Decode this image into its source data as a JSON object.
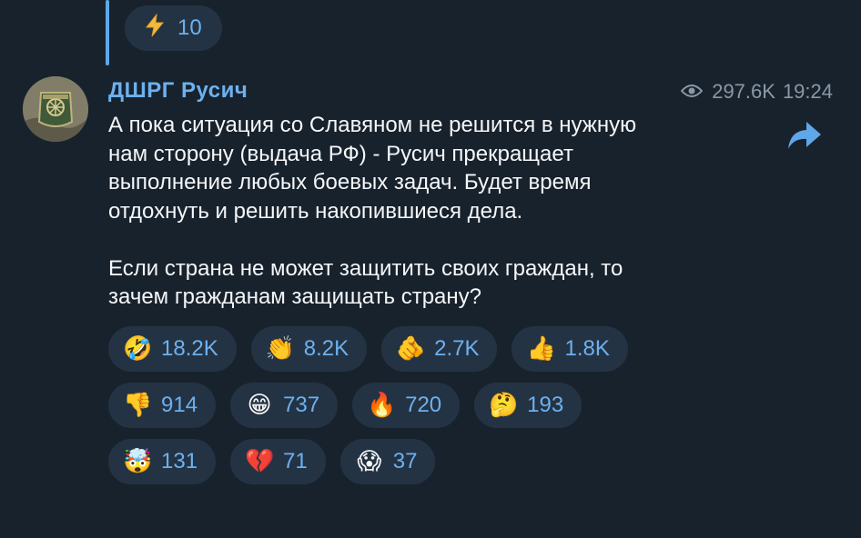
{
  "previous_message": {
    "reaction": {
      "icon": "lightning-icon",
      "emoji": "⚡",
      "count": "10"
    }
  },
  "message": {
    "author": "ДШРГ Русич",
    "views": "297.6K",
    "time": "19:24",
    "paragraphs": [
      "А пока ситуация со Славяном не решится в нужную\nнам сторону (выдача РФ) - Русич прекращает\nвыполнение любых боевых задач. Будет время\nотдохнуть и решить накопившиеся дела.",
      "Если страна не может защитить своих граждан, то\nзачем гражданам защищать страну?"
    ]
  },
  "reactions": [
    [
      {
        "icon": "rofl-icon",
        "emoji": "🤣",
        "count": "18.2K"
      },
      {
        "icon": "clap-icon",
        "emoji": "👏",
        "count": "8.2K"
      },
      {
        "icon": "pointing-hand-icon",
        "emoji": "🫵",
        "count": "2.7K"
      },
      {
        "icon": "thumbs-up-icon",
        "emoji": "👍",
        "count": "1.8K"
      }
    ],
    [
      {
        "icon": "thumbs-down-icon",
        "emoji": "👎",
        "count": "914"
      },
      {
        "icon": "grin-icon",
        "emoji": "😁",
        "count": "737"
      },
      {
        "icon": "fire-icon",
        "emoji": "🔥",
        "count": "720"
      },
      {
        "icon": "thinking-icon",
        "emoji": "🤔",
        "count": "193"
      }
    ],
    [
      {
        "icon": "mind-blown-icon",
        "emoji": "🤯",
        "count": "131"
      },
      {
        "icon": "broken-heart-icon",
        "emoji": "💔",
        "count": "71"
      },
      {
        "icon": "scream-icon",
        "emoji": "😱",
        "count": "37"
      }
    ]
  ],
  "colors": {
    "background": "#18222d",
    "accent": "#6cb1f0",
    "reaction_bg": "#243343",
    "meta": "#8a98a7"
  }
}
